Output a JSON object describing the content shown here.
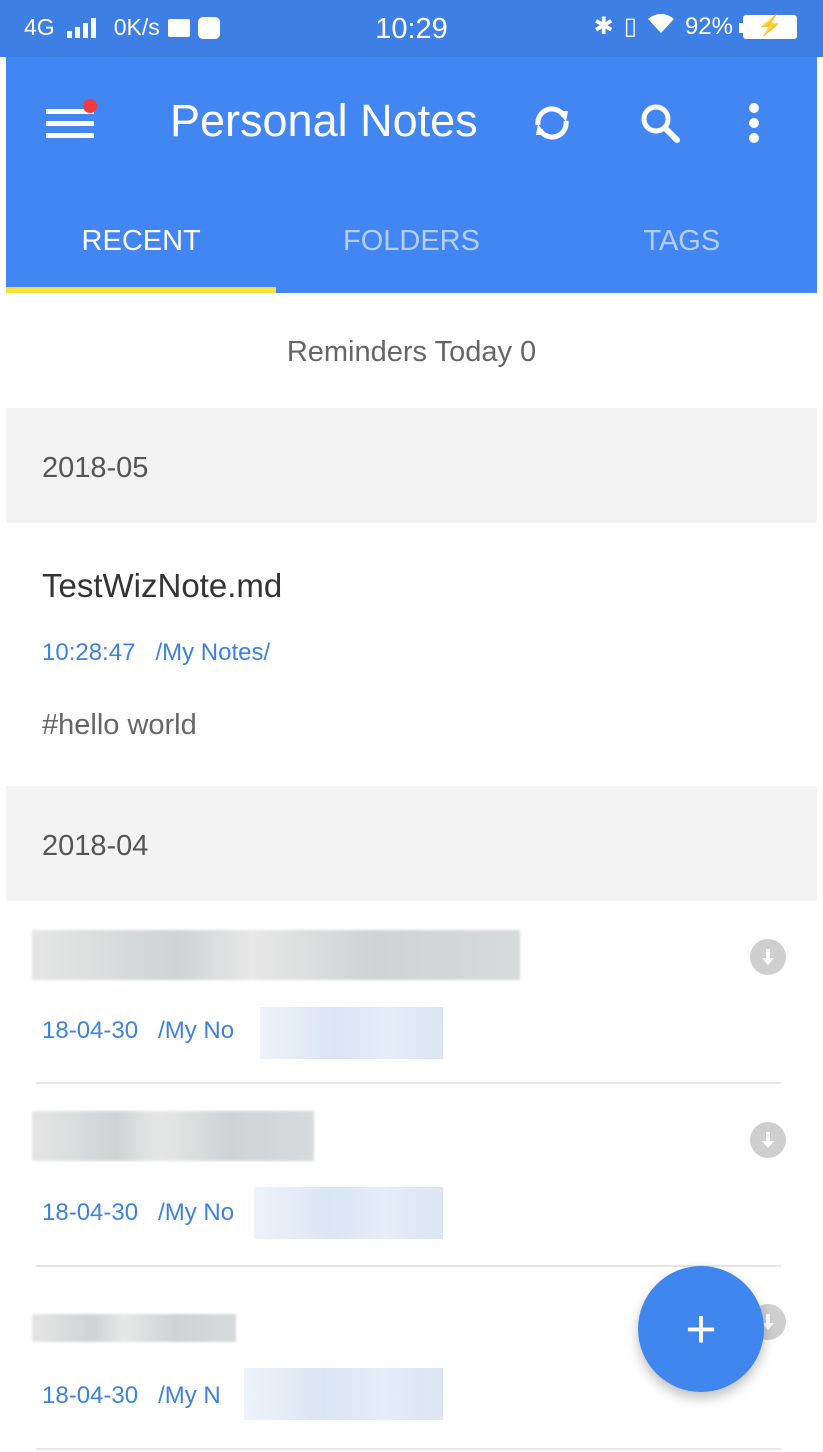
{
  "status_bar": {
    "network": "4G",
    "speed": "0K/s",
    "time": "10:29",
    "battery": "92%"
  },
  "app_bar": {
    "title": "Personal Notes",
    "icons": [
      "menu-icon",
      "sync-icon",
      "search-icon",
      "more-vert-icon"
    ]
  },
  "tabs": [
    {
      "label": "RECENT",
      "active": true
    },
    {
      "label": "FOLDERS",
      "active": false
    },
    {
      "label": "TAGS",
      "active": false
    }
  ],
  "reminders": "Reminders Today 0",
  "sections": [
    {
      "header": "2018-05",
      "notes": [
        {
          "title": "TestWizNote.md",
          "time": "10:28:47",
          "folder": "/My Notes/",
          "snippet": "#hello world"
        }
      ]
    },
    {
      "header": "2018-04",
      "notes": [
        {
          "date": "18-04-30",
          "folder_partial": "/My No"
        },
        {
          "date": "18-04-30",
          "folder_partial": "/My No"
        },
        {
          "date": "18-04-30",
          "folder_partial": "/My N"
        }
      ]
    }
  ],
  "fab": {
    "label": "+"
  },
  "colors": {
    "primary": "#4286f4",
    "tab_indicator": "#f6e23a",
    "link": "#3d82e0"
  }
}
